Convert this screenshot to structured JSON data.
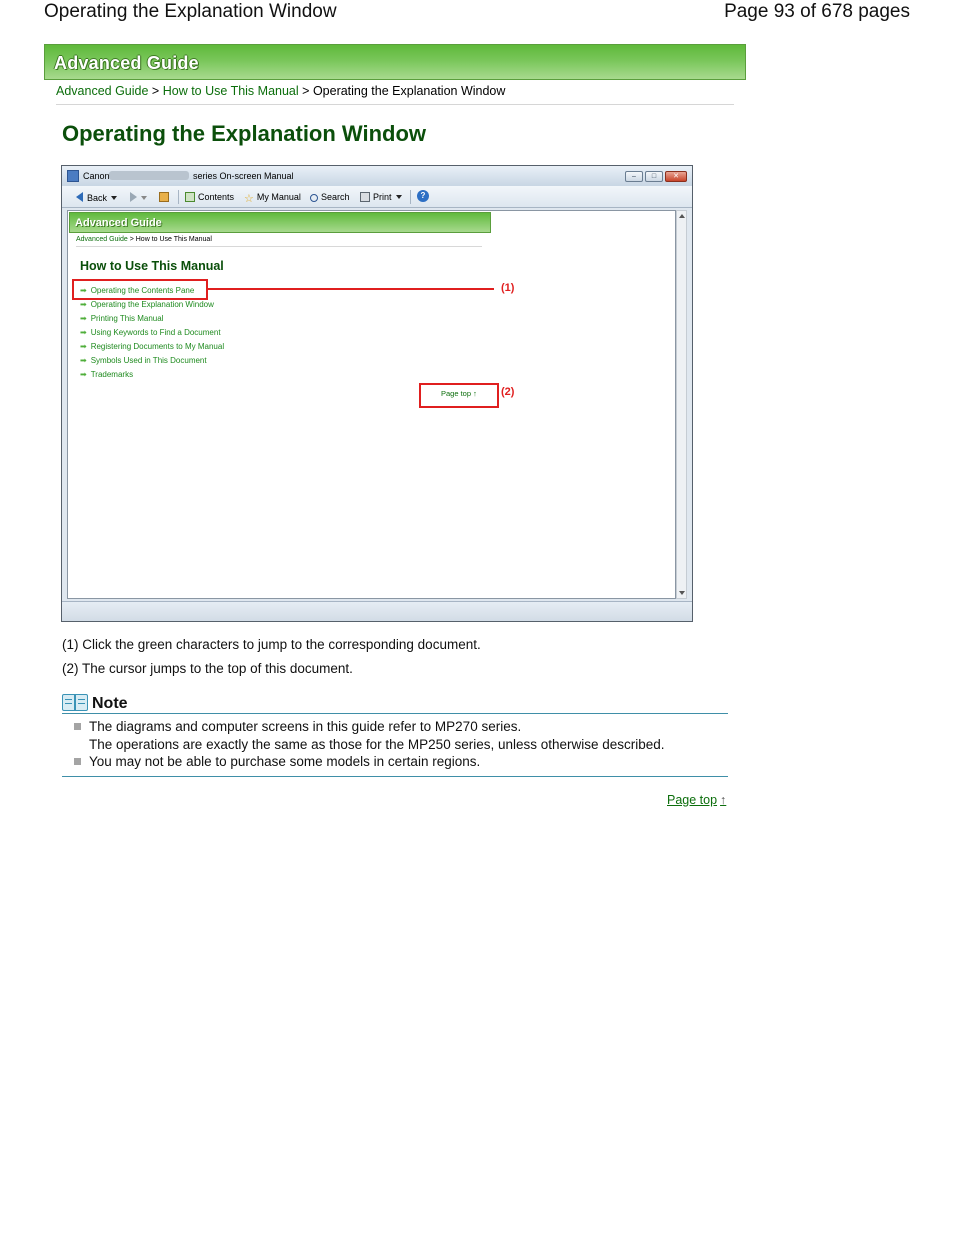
{
  "header": {
    "doc_title": "Operating the Explanation Window",
    "page_info": "Page 93 of 678 pages"
  },
  "banner": {
    "label": "Advanced Guide"
  },
  "breadcrumb": {
    "items": [
      "Advanced Guide",
      "How to Use This Manual"
    ],
    "separator": ">",
    "current": "Operating the Explanation Window"
  },
  "page_title": "Operating the Explanation Window",
  "screenshot": {
    "window_title_left": "Canon",
    "window_title_right": "series On-screen Manual",
    "toolbar": {
      "back": "Back",
      "contents": "Contents",
      "my_manual": "My Manual",
      "search": "Search",
      "print": "Print"
    },
    "inner_banner": "Advanced Guide",
    "inner_breadcrumb": {
      "link": "Advanced Guide",
      "rest": "> How to Use This Manual"
    },
    "inner_title": "How to Use This Manual",
    "links": [
      "Operating the Contents Pane",
      "Operating the Explanation Window",
      "Printing This Manual",
      "Using Keywords to Find a Document",
      "Registering Documents to My Manual",
      "Symbols Used in This Document",
      "Trademarks"
    ],
    "page_top": "Page top",
    "callout_1": "(1)",
    "callout_2": "(2)",
    "callout_color": "#e01f1f"
  },
  "descriptions": [
    "(1) Click the green characters to jump to the corresponding document.",
    "(2) The cursor jumps to the top of this document."
  ],
  "note": {
    "title": "Note",
    "items": [
      {
        "line1": "The diagrams and computer screens in this guide refer to MP270 series.",
        "line2": "The operations are exactly the same as those for the MP250 series, unless otherwise described."
      },
      {
        "line1": "You may not be able to purchase some models in certain regions."
      }
    ]
  },
  "page_top_link": "Page top",
  "colors": {
    "link": "#0c6e0c",
    "title": "#0b4f0b",
    "banner": "#79c65a",
    "note_rule": "#3f8fa8"
  }
}
